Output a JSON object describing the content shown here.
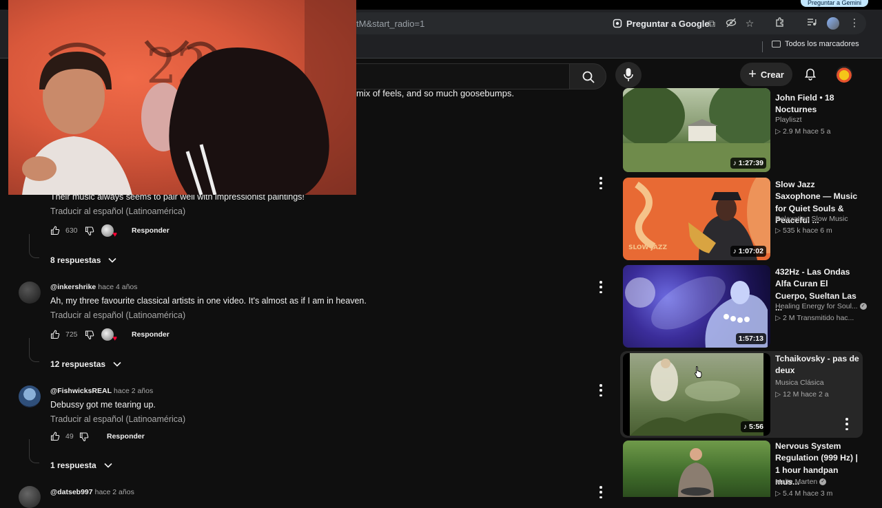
{
  "browser": {
    "top_button_label": "Preguntar a Gemini",
    "url_fragment": "tM&start_radio=1",
    "google_lens_label": "Preguntar a Google",
    "bookmarks_all_label": "Todos los marcadores"
  },
  "youtube_header": {
    "create_label": "Crear"
  },
  "comments": {
    "cut_text": "mix of feels, and so much goosebumps.",
    "items": [
      {
        "text": "Their music always seems to pair well with impressionist paintings!",
        "translate_label": "Traducir al español (Latinoamérica)",
        "likes": "630",
        "reply_label": "Responder",
        "replies_label": "8 respuestas"
      },
      {
        "author": "@inkershrike",
        "age": "hace 4 años",
        "text": "Ah, my three favourite classical artists in one video. It's almost as if I am in heaven.",
        "translate_label": "Traducir al español (Latinoamérica)",
        "likes": "725",
        "reply_label": "Responder",
        "replies_label": "12 respuestas"
      },
      {
        "author": "@FishwicksREAL",
        "age": "hace 2 años",
        "text": "Debussy got me tearing up.",
        "translate_label": "Traducir al español (Latinoamérica)",
        "likes": "49",
        "reply_label": "Responder",
        "replies_label": "1 respuesta"
      },
      {
        "author": "@datseb997",
        "age": "hace 2 años"
      }
    ]
  },
  "related": [
    {
      "title": "John Field • 18 Nocturnes",
      "channel": "Playliszt",
      "meta": "▷ 2.9 M   hace 5 a",
      "duration": "1:27:39"
    },
    {
      "title": "Slow Jazz Saxophone — Music for Quiet Souls & Peaceful ...",
      "channel": "Relaxation Slow Music",
      "meta": "▷ 535 k   hace 6 m",
      "duration": "1:07:02",
      "thumb_text": "SLOW JAZZ"
    },
    {
      "title": "432Hz - Las Ondas Alfa Curan El Cuerpo, Sueltan Las ...",
      "channel": "Healing Energy for Soul...",
      "meta": "▷ 2 M   Transmitido hac...",
      "duration": "1:57:13"
    },
    {
      "title": "Tchaikovsky - pas de deux",
      "channel": "Musica Clásica",
      "meta": "▷ 12 M   hace 2 a",
      "duration": "5:56"
    },
    {
      "title": "Nervous System Regulation (999 Hz) | 1 hour handpan mus...",
      "channel": "Malte Marten",
      "meta": "▷ 5.4 M   hace 3 m"
    }
  ]
}
